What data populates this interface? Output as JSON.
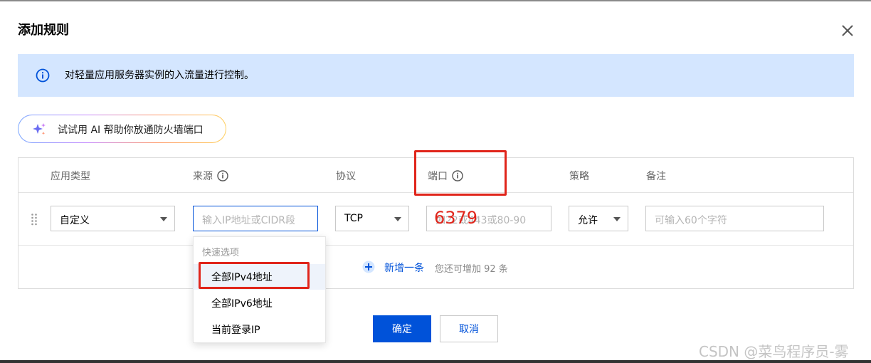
{
  "dialog": {
    "title": "添加规则",
    "notice": "对轻量应用服务器实例的入流量进行控制。",
    "ai_button": "试试用 AI 帮助你放通防火墙端口"
  },
  "table": {
    "headers": {
      "app_type": "应用类型",
      "source": "来源",
      "protocol": "协议",
      "port": "端口",
      "policy": "策略",
      "remark": "备注"
    },
    "row": {
      "app_type": "自定义",
      "source_placeholder": "输入IP地址或CIDR段",
      "protocol": "TCP",
      "port_placeholder": "如22或443或80-90",
      "port_annotation": "6379",
      "policy": "允许",
      "remark_placeholder": "可输入60个字符"
    },
    "add_row": {
      "label": "新增一条",
      "hint": "您还可增加 92 条"
    }
  },
  "dropdown": {
    "group_label": "快速选项",
    "items": [
      "全部IPv4地址",
      "全部IPv6地址",
      "当前登录IP"
    ]
  },
  "footer": {
    "confirm": "确定",
    "cancel": "取消"
  },
  "watermark": "CSDN @菜鸟程序员-雾",
  "colors": {
    "primary": "#0052d9",
    "notice_bg": "#d4e6ff",
    "highlight": "#e0251b"
  },
  "icons": [
    "close-icon",
    "info-icon",
    "sparkle-icon",
    "drag-handle-icon",
    "chevron-down-icon",
    "plus-circle-icon"
  ]
}
